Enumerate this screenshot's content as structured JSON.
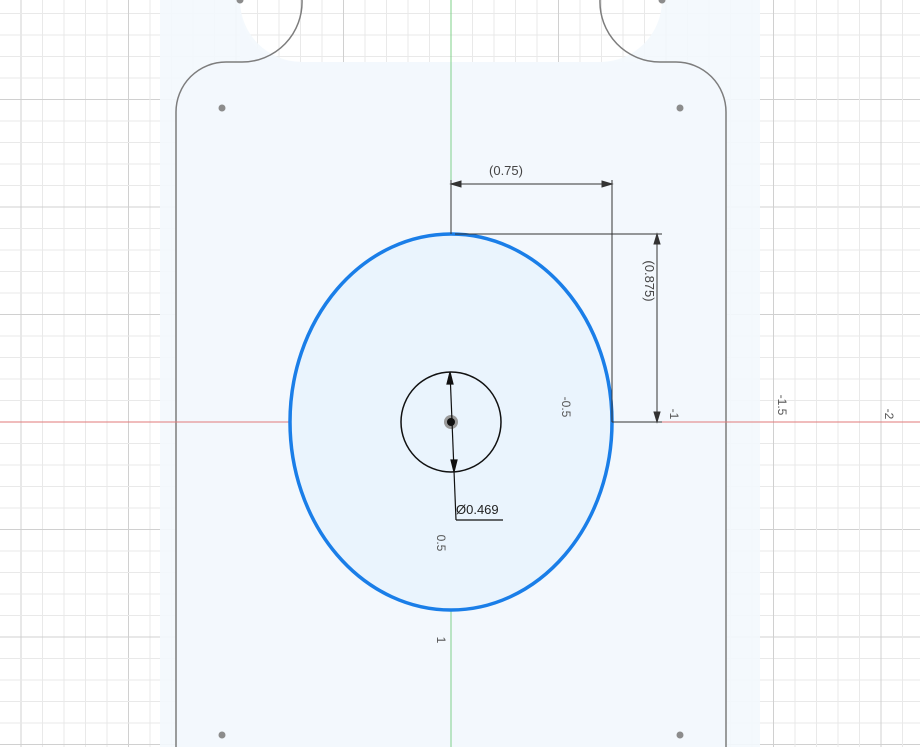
{
  "sketch": {
    "dimensions": {
      "horizontal": "(0.75)",
      "vertical": "(0.875)",
      "diameter": "Ø0.469"
    },
    "axis_ticks": {
      "x_neg_0_5": "-0.5",
      "x_neg_1": "-1",
      "x_neg_1_5": "-1.5",
      "x_neg_2": "-2",
      "y_0_5": "0.5",
      "y_1": "1"
    },
    "colors": {
      "profile_fill": "#eaf4fd",
      "ellipse_stroke": "#1a7ee8",
      "outline_stroke": "#7d7d7d",
      "x_axis": "#e07a7a",
      "y_axis": "#7fd08a",
      "grid_minor": "#e9e9e9",
      "grid_major": "#d0d0d0",
      "dimension": "#333333"
    }
  }
}
